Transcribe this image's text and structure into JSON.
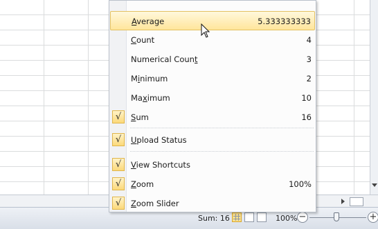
{
  "menu": {
    "items": [
      {
        "prefix": "",
        "ul": "A",
        "suffix": "verage",
        "value": "5.333333333",
        "checked": false,
        "highlight": true
      },
      {
        "prefix": "",
        "ul": "C",
        "suffix": "ount",
        "value": "4",
        "checked": false
      },
      {
        "prefix": "Numerical Coun",
        "ul": "t",
        "suffix": "",
        "value": "3",
        "checked": false
      },
      {
        "prefix": "M",
        "ul": "i",
        "suffix": "nimum",
        "value": "2",
        "checked": false
      },
      {
        "prefix": "Ma",
        "ul": "x",
        "suffix": "imum",
        "value": "10",
        "checked": false
      },
      {
        "prefix": "",
        "ul": "S",
        "suffix": "um",
        "value": "16",
        "checked": true
      },
      {
        "prefix": "",
        "ul": "U",
        "suffix": "pload Status",
        "value": "",
        "checked": true
      },
      {
        "prefix": "",
        "ul": "V",
        "suffix": "iew Shortcuts",
        "value": "",
        "checked": true
      },
      {
        "prefix": "",
        "ul": "Z",
        "suffix": "oom",
        "value": "100%",
        "checked": true
      },
      {
        "prefix": "",
        "ul": "Z",
        "suffix": "oom Slider",
        "value": "",
        "checked": true
      }
    ],
    "check_glyph": "√"
  },
  "statusbar": {
    "sum": "Sum: 16",
    "zoom": "100%",
    "zoom_out": "−",
    "zoom_in": "+",
    "zoom_level": 1.0
  },
  "colors": {
    "highlight": "#ffe59b",
    "check_bg": "#fcd97a"
  }
}
